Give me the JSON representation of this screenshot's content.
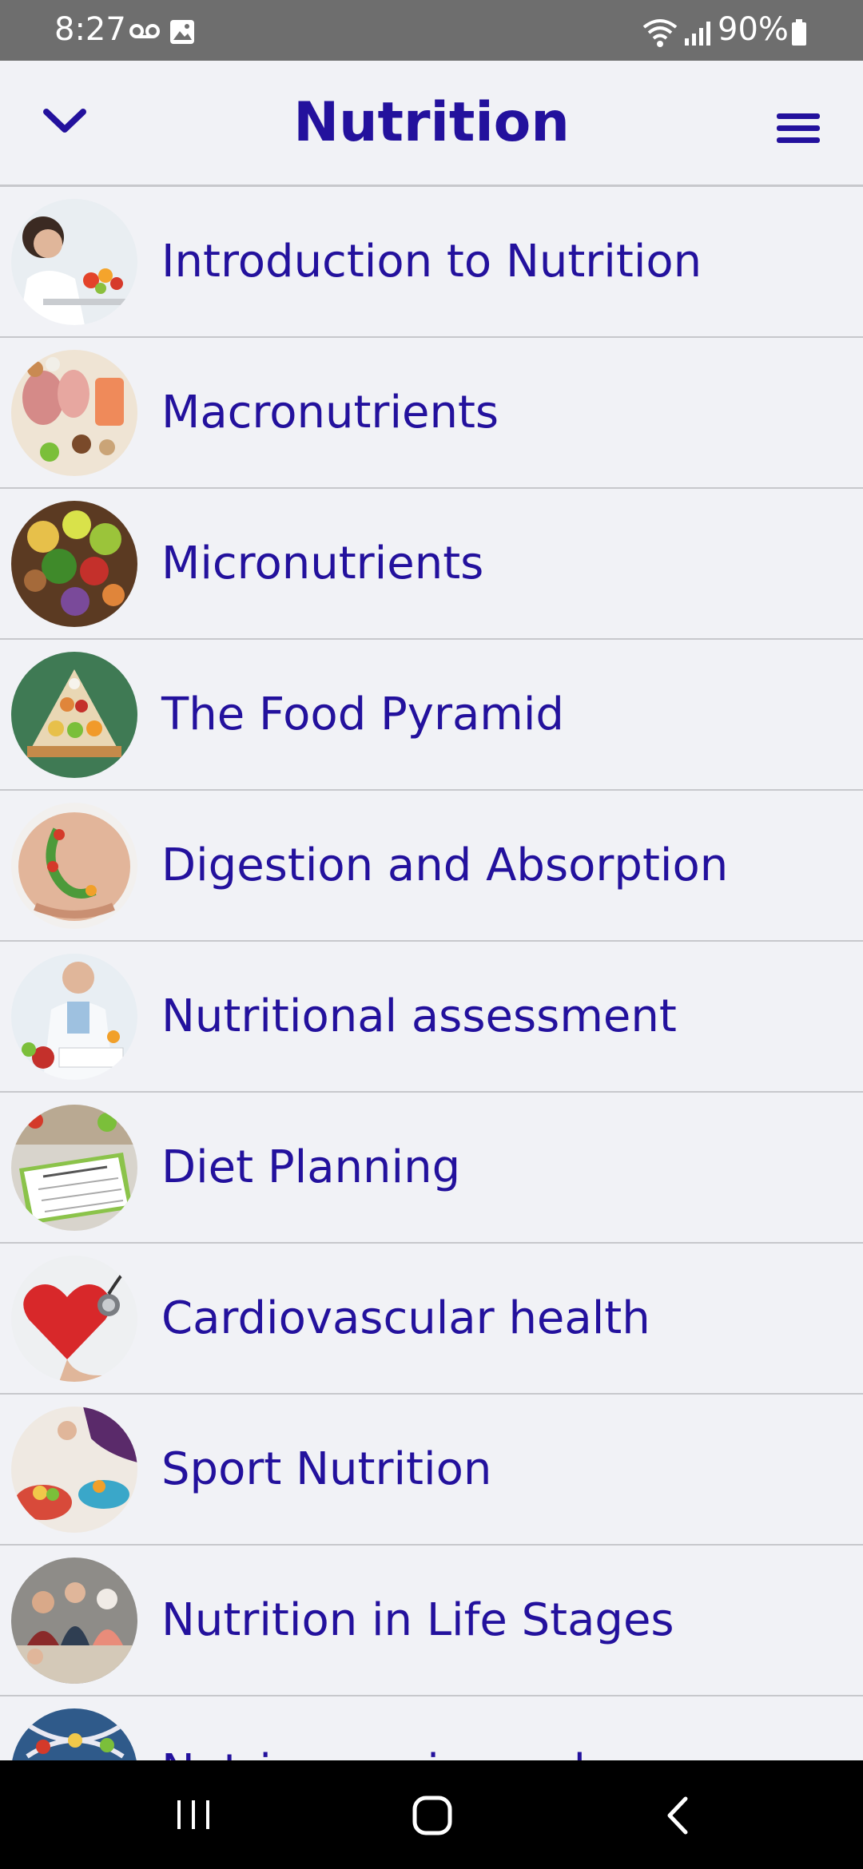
{
  "status_bar": {
    "time": "8:27",
    "battery": "90%",
    "icons": [
      "voicemail-icon",
      "image-icon",
      "wifi-icon",
      "signal-icon",
      "battery-icon"
    ]
  },
  "header": {
    "title": "Nutrition",
    "left_icon": "chevron-down-icon",
    "right_icon": "menu-icon"
  },
  "colors": {
    "accent": "#23119d",
    "background": "#f1f2f6",
    "divider": "#c7c8cc"
  },
  "topics": [
    {
      "label": "Introduction to Nutrition",
      "thumb": "nutritionist-photo"
    },
    {
      "label": "Macronutrients",
      "thumb": "protein-foods-photo"
    },
    {
      "label": "Micronutrients",
      "thumb": "fruits-nuts-photo"
    },
    {
      "label": "The Food Pyramid",
      "thumb": "food-pyramid-photo"
    },
    {
      "label": "Digestion and Absorption",
      "thumb": "stomach-photo"
    },
    {
      "label": "Nutritional assessment",
      "thumb": "doctor-writing-photo"
    },
    {
      "label": "Diet Planning",
      "thumb": "diet-plan-photo"
    },
    {
      "label": "Cardiovascular health",
      "thumb": "heart-stethoscope-photo"
    },
    {
      "label": "Sport Nutrition",
      "thumb": "sport-food-photo"
    },
    {
      "label": "Nutrition in Life Stages",
      "thumb": "family-cooking-photo"
    },
    {
      "label": "Nutrigenomics and",
      "thumb": "dna-food-photo"
    }
  ],
  "nav_bar": {
    "icons": [
      "recent-apps-icon",
      "home-icon",
      "back-icon"
    ]
  }
}
